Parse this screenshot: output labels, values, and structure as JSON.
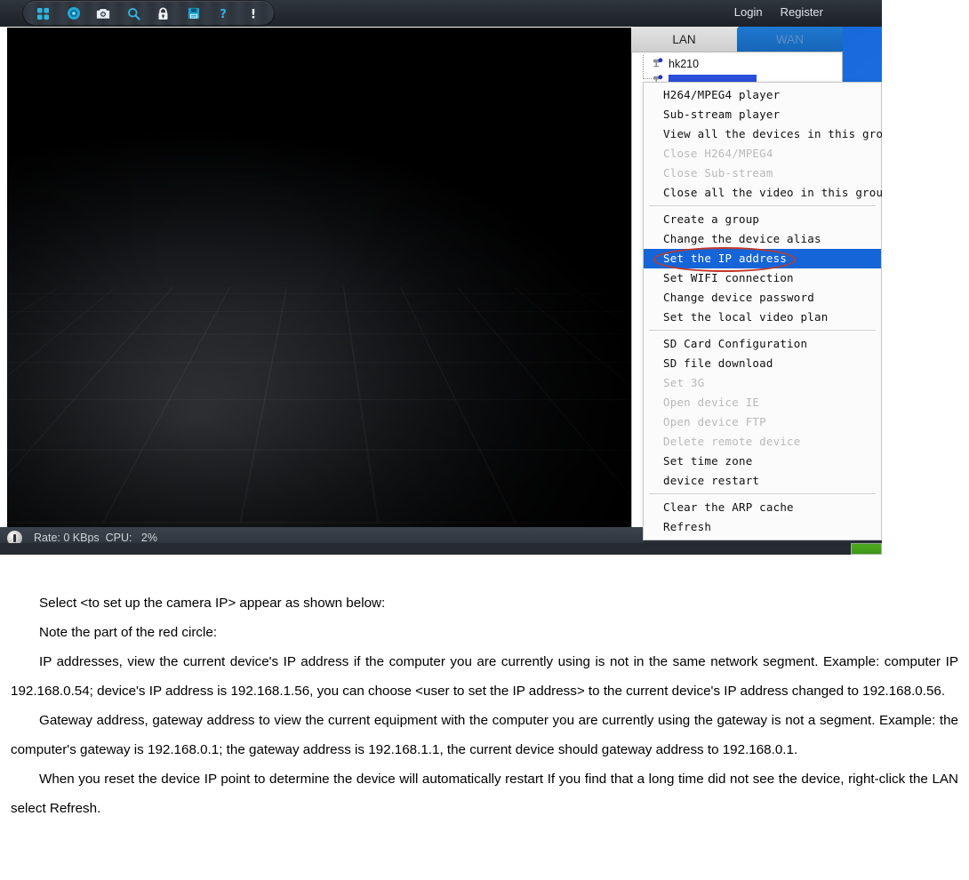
{
  "app": {
    "toolbar": {
      "icons": [
        {
          "name": "layout-grid-icon",
          "glyph": "grid"
        },
        {
          "name": "record-target-icon",
          "glyph": "target"
        },
        {
          "name": "camera-snapshot-icon",
          "glyph": "camera"
        },
        {
          "name": "search-icon",
          "glyph": "search"
        },
        {
          "name": "lock-icon",
          "glyph": "lock"
        },
        {
          "name": "save-disk-icon",
          "glyph": "disk"
        },
        {
          "name": "help-question-icon",
          "glyph": "question"
        },
        {
          "name": "alert-exclamation-icon",
          "glyph": "exclamation"
        }
      ]
    },
    "account": {
      "login_label": "Login",
      "register_label": "Register"
    },
    "tabs": {
      "lan_label": "LAN",
      "wan_label": "WAN",
      "active": "LAN"
    },
    "tree": {
      "items": [
        {
          "label": "hk210",
          "selected": false
        },
        {
          "label": "",
          "selected": true
        }
      ]
    },
    "status": {
      "text": "Rate: 0 KBps  CPU:   2%",
      "rate": "0 KBps",
      "cpu": "2%"
    },
    "context_menu": {
      "groups": [
        {
          "items": [
            {
              "label": "H264/MPEG4 player",
              "state": "normal"
            },
            {
              "label": "Sub-stream player",
              "state": "normal"
            },
            {
              "label": "View all the devices in this group",
              "state": "normal"
            },
            {
              "label": "Close H264/MPEG4",
              "state": "disabled"
            },
            {
              "label": "Close Sub-stream",
              "state": "disabled"
            },
            {
              "label": "Close all the video in this group",
              "state": "normal"
            }
          ]
        },
        {
          "items": [
            {
              "label": "Create a group",
              "state": "normal"
            },
            {
              "label": "Change the device alias",
              "state": "normal"
            },
            {
              "label": "Set the IP address",
              "state": "highlight"
            },
            {
              "label": "Set WIFI connection",
              "state": "normal"
            },
            {
              "label": "Change device password",
              "state": "normal"
            },
            {
              "label": "Set the local video plan",
              "state": "normal"
            }
          ]
        },
        {
          "items": [
            {
              "label": "SD Card Configuration",
              "state": "normal"
            },
            {
              "label": "SD file download",
              "state": "normal"
            },
            {
              "label": "Set 3G",
              "state": "disabled"
            },
            {
              "label": "Open device IE",
              "state": "disabled"
            },
            {
              "label": "Open device FTP",
              "state": "disabled"
            },
            {
              "label": "Delete remote device",
              "state": "disabled"
            },
            {
              "label": "Set time zone",
              "state": "normal"
            },
            {
              "label": "device restart",
              "state": "normal"
            }
          ]
        },
        {
          "items": [
            {
              "label": "Clear the ARP cache",
              "state": "normal"
            },
            {
              "label": "Refresh",
              "state": "normal"
            }
          ]
        }
      ]
    },
    "annotation": {
      "type": "red-ellipse",
      "target": "Set the IP address",
      "color": "#c0392b"
    }
  },
  "document": {
    "paragraphs": [
      "Select <to set up the camera IP> appear as shown below:",
      "Note the part of the red circle:",
      "IP addresses, view the current device's IP address if the computer you are currently using is not in the same network segment. Example: computer IP 192.168.0.54; device's IP address is 192.168.1.56, you can choose <user to set the IP address> to the current device's IP address changed to 192.168.0.56.",
      "Gateway address, gateway address to view the current equipment with the computer you are currently using the gateway is not a segment. Example: the computer's gateway is 192.168.0.1; the gateway address is 192.168.1.1, the current device should gateway address to 192.168.0.1.",
      "When you reset the device IP point to determine the device will automatically restart If you find that a long time did not see the device, right-click the LAN select Refresh."
    ]
  },
  "colors": {
    "menu_highlight": "#1565d8",
    "annotation_red": "#c0392b",
    "tab_active_bg": "#d8d8d8",
    "tab_inactive_bg": "#1f78cf",
    "progress_green": "#4fae20"
  }
}
